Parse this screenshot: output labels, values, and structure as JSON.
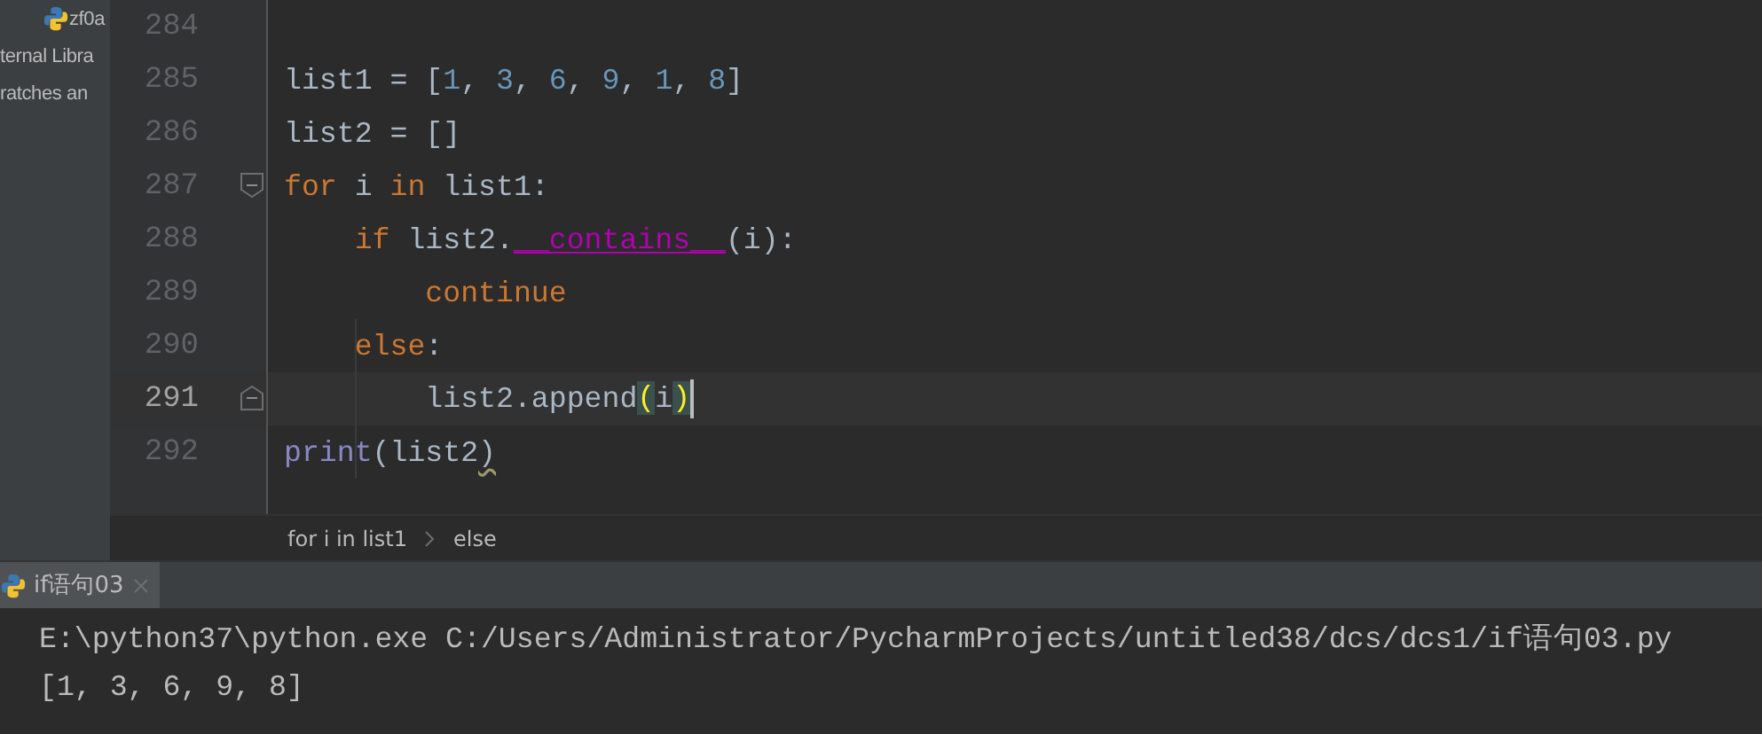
{
  "project_tree": {
    "items": [
      {
        "label": "zf0a",
        "kind": "python-file"
      },
      {
        "label": "ternal Libra",
        "kind": "library"
      },
      {
        "label": "ratches an",
        "kind": "scratches"
      }
    ]
  },
  "editor": {
    "lines": [
      {
        "number": "284",
        "current": false,
        "fold_start": false,
        "fold_end": false
      },
      {
        "number": "285",
        "current": false,
        "fold_start": false,
        "fold_end": false,
        "tokens": [
          {
            "text": "list1 = [",
            "kind": "ident"
          },
          {
            "text": "1",
            "kind": "number"
          },
          {
            "text": ", ",
            "kind": "ident"
          },
          {
            "text": "3",
            "kind": "number"
          },
          {
            "text": ", ",
            "kind": "ident"
          },
          {
            "text": "6",
            "kind": "number"
          },
          {
            "text": ", ",
            "kind": "ident"
          },
          {
            "text": "9",
            "kind": "number"
          },
          {
            "text": ", ",
            "kind": "ident"
          },
          {
            "text": "1",
            "kind": "number"
          },
          {
            "text": ", ",
            "kind": "ident"
          },
          {
            "text": "8",
            "kind": "number"
          },
          {
            "text": "]",
            "kind": "ident"
          }
        ]
      },
      {
        "number": "286",
        "current": false,
        "fold_start": false,
        "fold_end": false,
        "tokens": [
          {
            "text": "list2 = []",
            "kind": "ident"
          }
        ]
      },
      {
        "number": "287",
        "current": false,
        "fold_start": true,
        "fold_end": false,
        "tokens": [
          {
            "text": "for",
            "kind": "keyword"
          },
          {
            "text": " i ",
            "kind": "ident"
          },
          {
            "text": "in",
            "kind": "keyword"
          },
          {
            "text": " list1:",
            "kind": "ident"
          }
        ]
      },
      {
        "number": "288",
        "current": false,
        "fold_start": false,
        "fold_end": false,
        "tokens": [
          {
            "text": "    if",
            "kind": "keyword"
          },
          {
            "text": " list2.",
            "kind": "ident"
          },
          {
            "text": "__contains__",
            "kind": "magic"
          },
          {
            "text": "(i):",
            "kind": "ident"
          }
        ]
      },
      {
        "number": "289",
        "current": false,
        "fold_start": false,
        "fold_end": false,
        "tokens": [
          {
            "text": "        continue",
            "kind": "keyword"
          }
        ]
      },
      {
        "number": "290",
        "current": false,
        "fold_start": false,
        "fold_end": false,
        "tokens": [
          {
            "text": "    else",
            "kind": "keyword"
          },
          {
            "text": ":",
            "kind": "ident"
          }
        ]
      },
      {
        "number": "291",
        "current": true,
        "fold_start": false,
        "fold_end": true,
        "tokens": [
          {
            "text": "        list2.append",
            "kind": "ident"
          },
          {
            "text": "(",
            "kind": "matched-bracket"
          },
          {
            "text": "i",
            "kind": "ident"
          },
          {
            "text": ")",
            "kind": "matched-bracket"
          }
        ]
      },
      {
        "number": "292",
        "current": false,
        "fold_start": false,
        "fold_end": false,
        "tokens": [
          {
            "text": "print",
            "kind": "builtin"
          },
          {
            "text": "(list2",
            "kind": "ident"
          },
          {
            "text": ")",
            "kind": "warning"
          }
        ]
      }
    ]
  },
  "breadcrumbs": [
    {
      "label": "for i in list1"
    },
    {
      "label": "else"
    }
  ],
  "run_panel": {
    "tabs": [
      {
        "label": "if语句03",
        "selected": true
      }
    ],
    "output": [
      "E:\\python37\\python.exe C:/Users/Administrator/PycharmProjects/untitled38/dcs/dcs1/if语句03.py",
      "[1, 3, 6, 9, 8]"
    ]
  }
}
